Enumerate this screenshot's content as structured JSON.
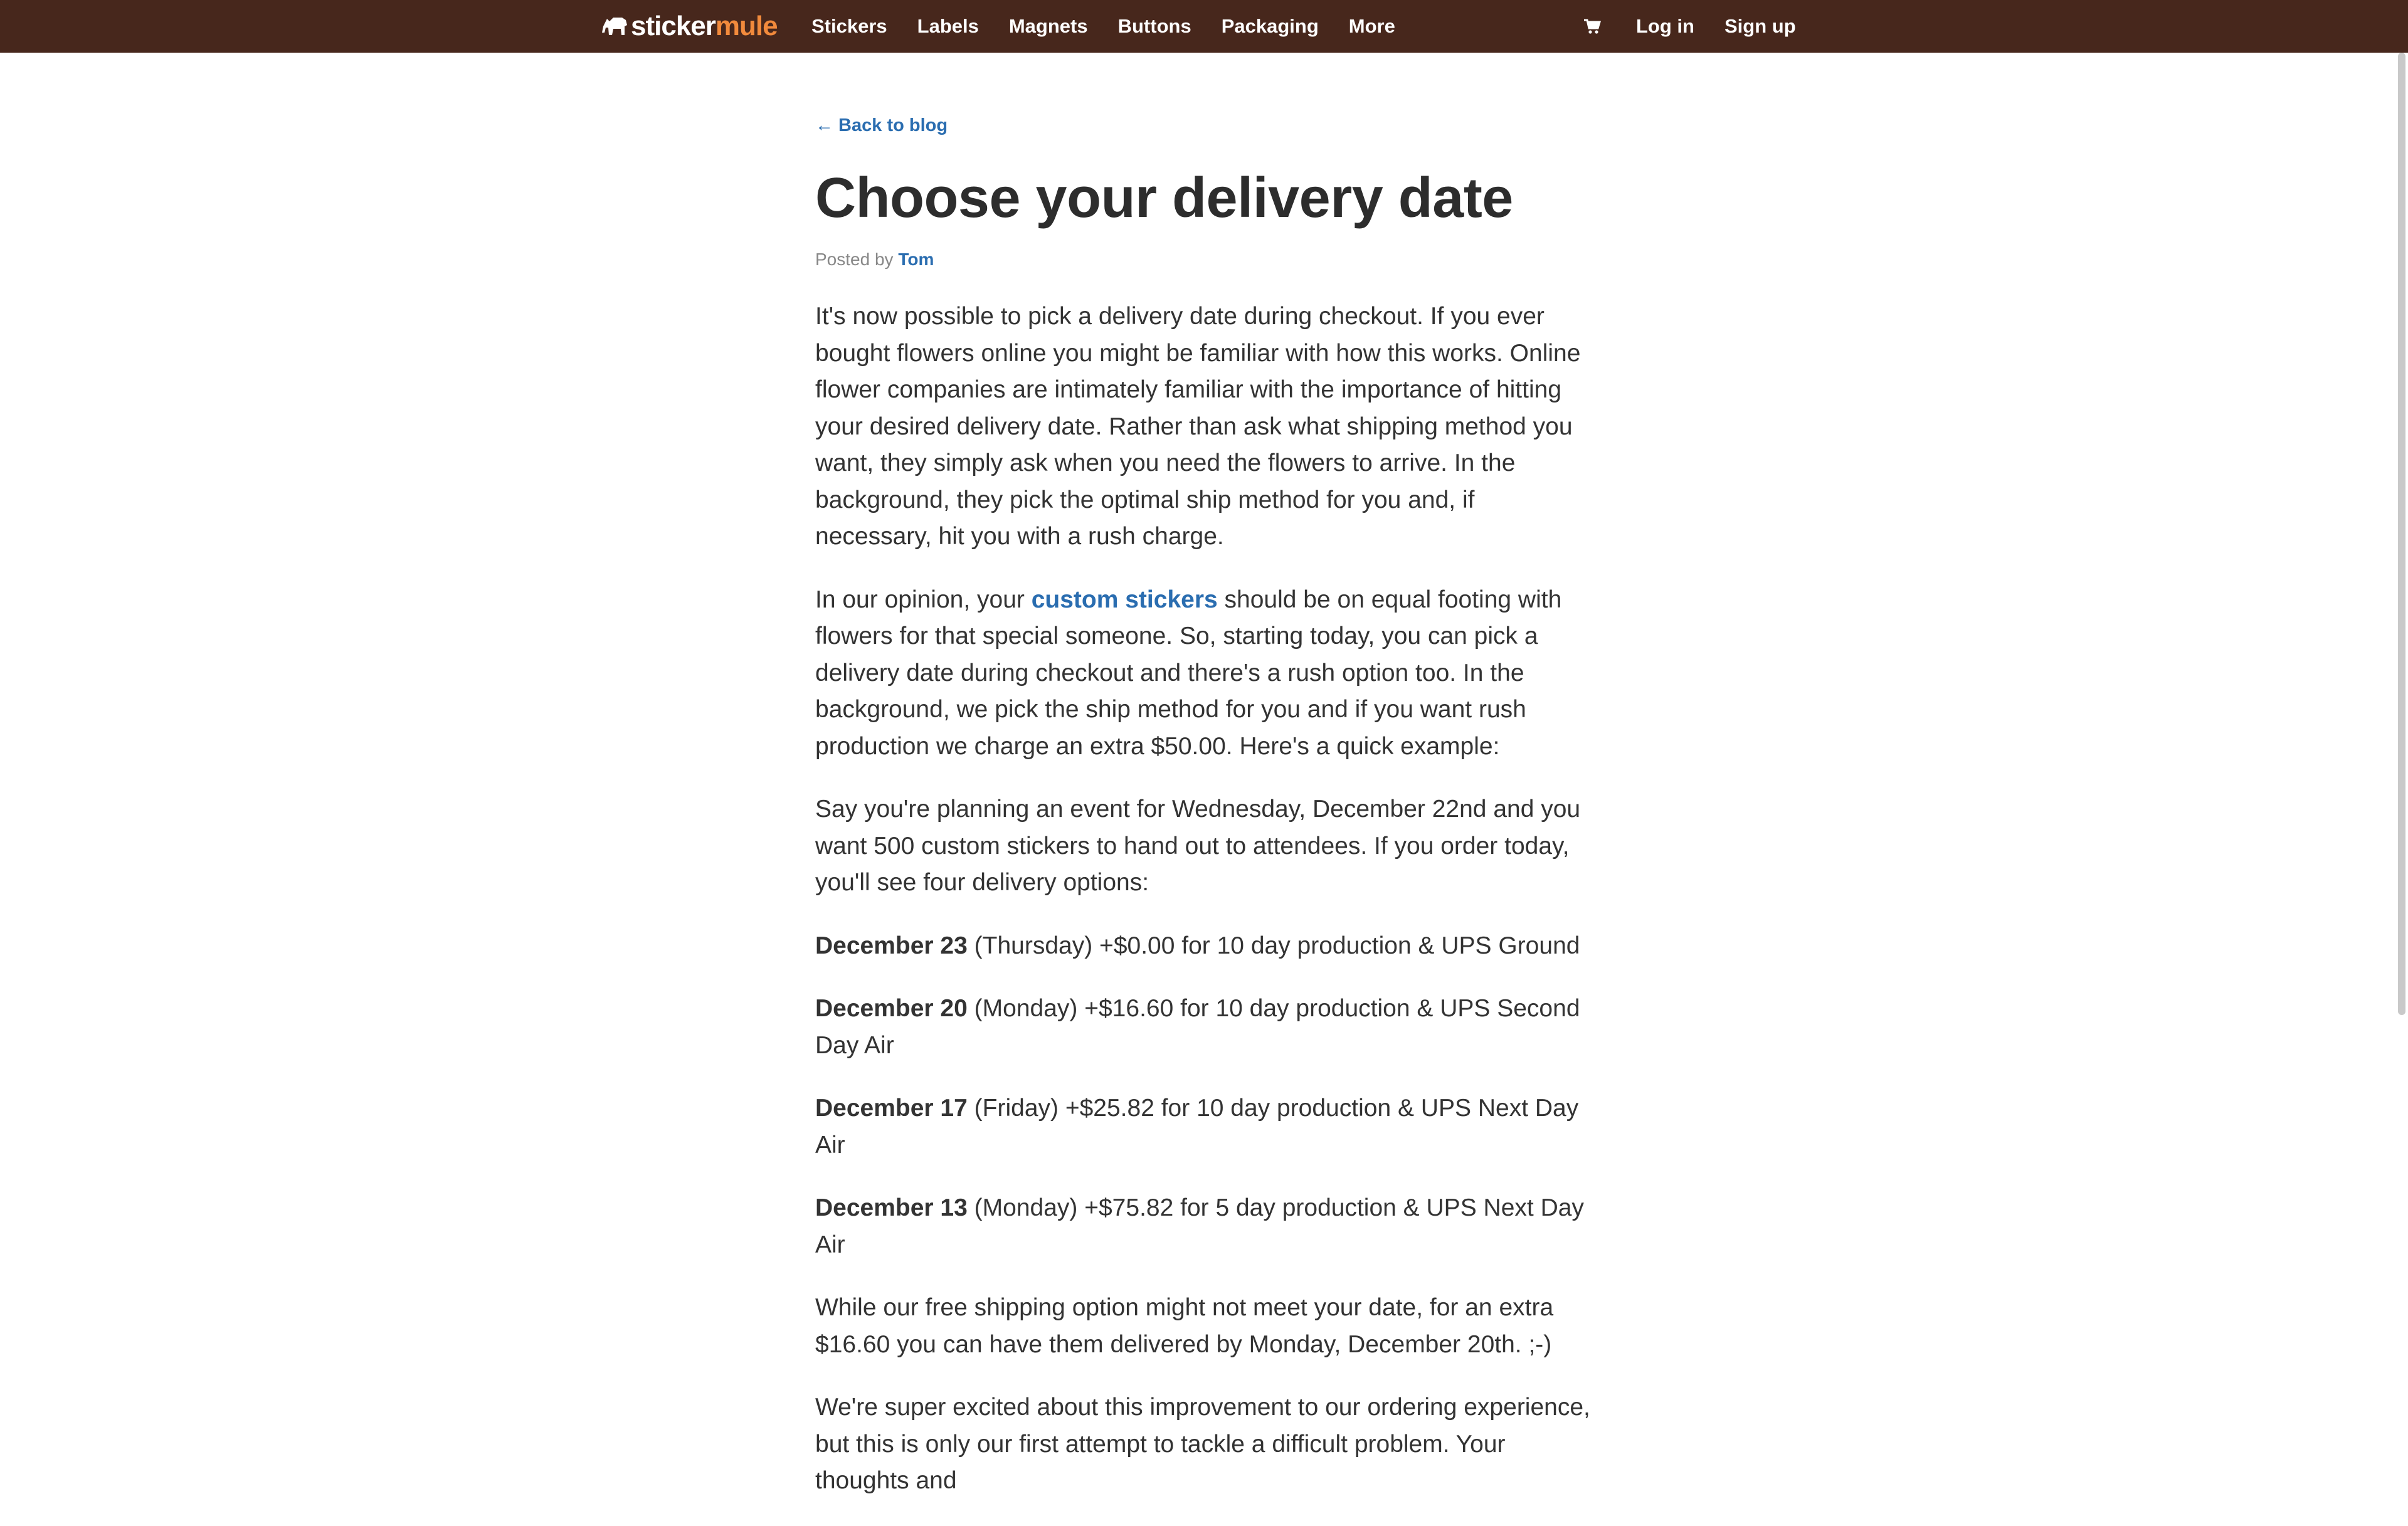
{
  "brand": {
    "logo_left": "sticker",
    "logo_right": "mule",
    "colors": {
      "topbar": "#47271c",
      "accent": "#f28a3c",
      "link": "#2a6db0"
    }
  },
  "nav": {
    "items": [
      "Stickers",
      "Labels",
      "Magnets",
      "Buttons",
      "Packaging",
      "More"
    ],
    "cart_icon": "cart-icon",
    "login": "Log in",
    "signup": "Sign up"
  },
  "article": {
    "back_link": "← Back to blog",
    "title": "Choose your delivery date",
    "posted_by_label": "Posted by",
    "author": "Tom",
    "p1": "It's now possible to pick a delivery date during checkout. If you ever bought flowers online you might be familiar with how this works. Online flower companies are intimately familiar with the importance of hitting your desired delivery date. Rather than ask what shipping method you want, they simply ask when you need the flowers to arrive. In the background, they pick the optimal ship method for you and, if necessary, hit you with a rush charge.",
    "p2_before": "In our opinion, your ",
    "p2_link": "custom stickers",
    "p2_after": " should be on equal footing with flowers for that special someone. So, starting today, you can pick a delivery date during checkout and there's a rush option too. In the background, we pick the ship method for you and if you want rush production we charge an extra $50.00. Here's a quick example:",
    "p3": "Say you're planning an event for Wednesday, December 22nd and you want 500 custom stickers to hand out to attendees. If you order today, you'll see four delivery options:",
    "options": [
      {
        "date": "December 23",
        "detail": " (Thursday) +$0.00 for 10 day production & UPS Ground"
      },
      {
        "date": "December 20",
        "detail": " (Monday) +$16.60 for 10 day production & UPS Second Day Air"
      },
      {
        "date": "December 17",
        "detail": " (Friday) +$25.82 for 10 day production & UPS Next Day Air"
      },
      {
        "date": "December 13",
        "detail": " (Monday) +$75.82 for 5 day production & UPS Next Day Air"
      }
    ],
    "p4": "While our free shipping option might not meet your date, for an extra $16.60 you can have them delivered by Monday, December 20th. ;-)",
    "p5": "We're super excited about this improvement to our ordering experience, but this is only our first attempt to tackle a difficult problem. Your thoughts and"
  }
}
